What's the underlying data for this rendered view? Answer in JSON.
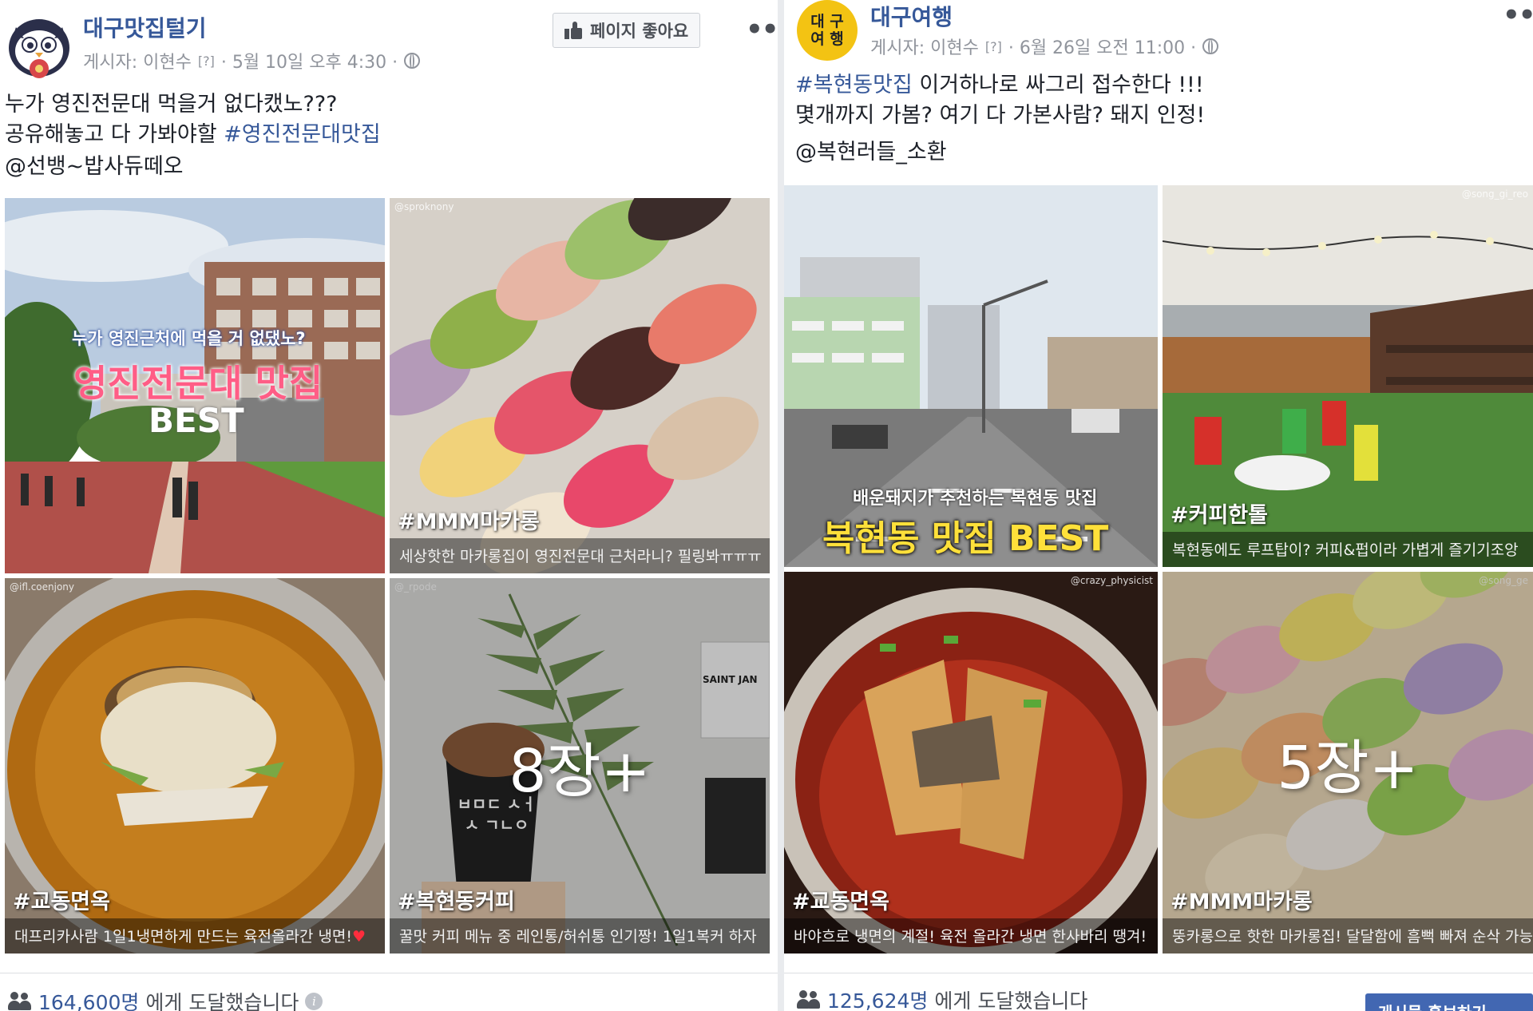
{
  "post1": {
    "page_name": "대구맛집털기",
    "posted_by": "게시자: 이현수",
    "q_mark": "[?]",
    "datetime": "· 5월 10일 오후 4:30 ·",
    "like_button": "페이지 좋아요",
    "more_icon": "•••",
    "line1": "누가 영진전문대 먹을거 없다캤노???",
    "line2_prefix": "공유해놓고 다 가봐야할 ",
    "line2_hashtag": "#영진전문대맛집",
    "line3": "@선뱅~밥사듀떼오",
    "tiles": {
      "t1_small": "누가 영진근처에 먹을 거 없댔노?",
      "t1_main": "영진전문대 맛집",
      "t1_best": "BEST",
      "t2_wm": "@sproknony",
      "t2_tag": "#MMM마카롱",
      "t2_caption": "세상핫한 마카롱집이 영진전문대 근처라니? 필링봐ㅠㅠㅠ",
      "t3_wm": "@ifl.coenjony",
      "t3_tag": "#교동면옥",
      "t3_caption": "대프리카사람 1일1냉면하게 만드는 육전올라간 냉면!",
      "t3_heart": "♥",
      "t4_wm": "@_rpode",
      "t4_tag": "#복현동커피",
      "t4_caption": "꿀맛 커피 메뉴 중 레인통/허쉬통 인기짱! 1일1복커 하자",
      "t4_more": "8장+",
      "t4_sign": "SAINT JAN",
      "t4_cup": "ㅂㅁㄷ ㅅㅓㅅ ㄱㄴㅇ"
    },
    "reach_count": "164,600명",
    "reach_suffix": "에게 도달했습니다",
    "info_icon": "i"
  },
  "post2": {
    "page_name": "대구여행",
    "avatar_text": "대구여행",
    "avatar_l1": "대 구",
    "avatar_l2": "여 행",
    "posted_by": "게시자: 이현수",
    "q_mark": "[?]",
    "datetime": "· 6월 26일 오전 11:00 ·",
    "more_icon": "•••",
    "line1_hashtag": "#복현동맛집",
    "line1_rest": " 이거하나로 싸그리 접수한다 !!!",
    "line2": "몇개까지 가봄? 여기 다 가본사람? 돼지 인정!",
    "line3": "@복현러들_소환",
    "tiles": {
      "t1_small": "배운돼지가 추천하는 복현동 맛집",
      "t1_main": "복현동 맛집 BEST",
      "t2_wm": "@song_gi_reo",
      "t2_tag": "#커피한톨",
      "t2_caption": "복현동에도 루프탑이? 커피&펍이라 가볍게 즐기기조앙",
      "t3_wm": "@crazy_physicist",
      "t3_tag": "#교동면옥",
      "t3_caption": "바야흐로 냉면의 계절! 육전 올라간 냉면 한사바리 땡겨!",
      "t4_wm": "@song_ge",
      "t4_tag": "#MMM마카롱",
      "t4_caption": "뚱카롱으로 핫한 마카롱집! 달달함에 흠뻑 빠져 순삭 가능",
      "t4_more": "5장+"
    },
    "reach_count": "125,624명",
    "reach_suffix": "에게 도달했습니다",
    "boost_button": "게시물 홍보하기"
  },
  "colors": {
    "link_blue": "#365899",
    "meta_gray": "#90949c",
    "divider": "#e9ebee",
    "boost_blue": "#4267b2"
  }
}
